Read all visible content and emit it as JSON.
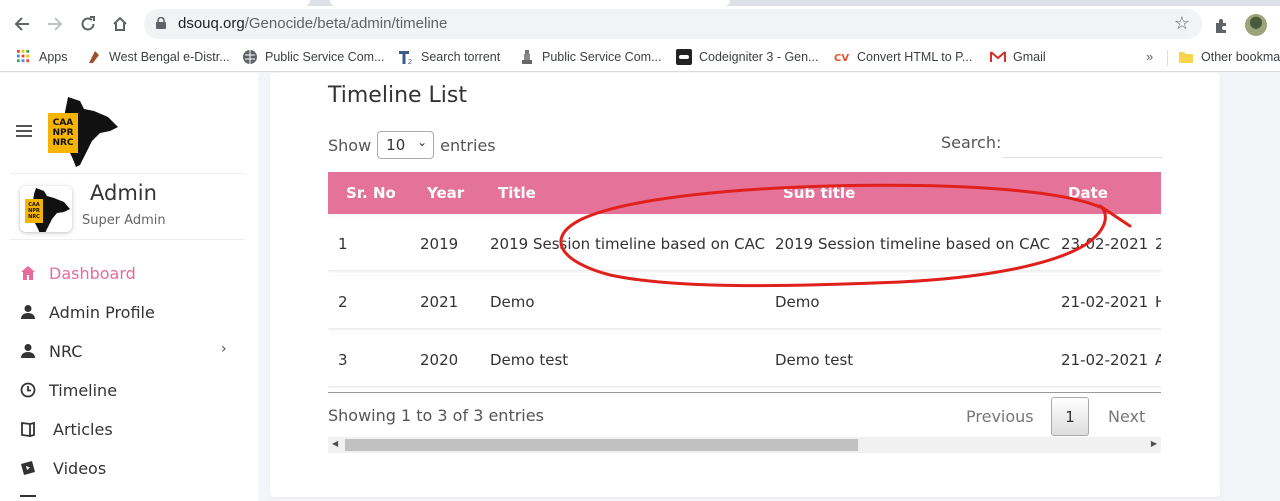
{
  "browser": {
    "url_host": "dsouq.org",
    "url_path": "/Genocide/beta/admin/timeline",
    "bookmarks": [
      {
        "label": "Apps",
        "icon": "apps-grid-icon"
      },
      {
        "label": "West Bengal e-Distr...",
        "icon": "bengal-icon"
      },
      {
        "label": "Public Service Com...",
        "icon": "globe-icon"
      },
      {
        "label": "Search torrent",
        "icon": "torrent-icon"
      },
      {
        "label": "Public Service Com...",
        "icon": "emblem-icon"
      },
      {
        "label": "Codeigniter 3 - Gen...",
        "icon": "codeigniter-icon"
      },
      {
        "label": "Convert HTML to P...",
        "icon": "convert-icon"
      },
      {
        "label": "Gmail",
        "icon": "gmail-icon"
      }
    ],
    "bookmarks_more": "»",
    "other_bookmarks": "Other bookma"
  },
  "sidebar": {
    "logo_text": [
      "CAA",
      "NPR",
      "NRC"
    ],
    "admin_name": "Admin",
    "admin_role": "Super Admin",
    "menu": [
      {
        "label": "Dashboard",
        "icon": "home-icon",
        "active": true
      },
      {
        "label": "Admin Profile",
        "icon": "user-icon"
      },
      {
        "label": "NRC",
        "icon": "user-icon",
        "has_submenu": true
      },
      {
        "label": "Timeline",
        "icon": "clock-icon"
      },
      {
        "label": "Articles",
        "icon": "book-icon"
      },
      {
        "label": "Videos",
        "icon": "video-icon"
      }
    ],
    "submenu_arrow": "›"
  },
  "main": {
    "title": "Timeline List",
    "show_label": "Show",
    "entries_label": "entries",
    "page_length": "10",
    "search_label": "Search:",
    "columns": [
      "Sr. No",
      "Year",
      "Title",
      "Sub title",
      "Date"
    ],
    "rows": [
      {
        "sr": "1",
        "year": "2019",
        "title": "2019 Session timeline based on CAC",
        "subtitle": "2019 Session timeline based on CAC",
        "date": "23-02-2021",
        "extra": "2"
      },
      {
        "sr": "2",
        "year": "2021",
        "title": "Demo",
        "subtitle": "Demo",
        "date": "21-02-2021",
        "extra": "H"
      },
      {
        "sr": "3",
        "year": "2020",
        "title": "Demo test",
        "subtitle": "Demo test",
        "date": "21-02-2021",
        "extra": "A"
      }
    ],
    "info": "Showing 1 to 3 of 3 entries",
    "previous": "Previous",
    "current_page": "1",
    "next": "Next"
  },
  "colors": {
    "accent": "#e57399",
    "active_menu": "#e86b9a",
    "annotation": "#e0201a",
    "logo_orange": "#f5b400"
  }
}
